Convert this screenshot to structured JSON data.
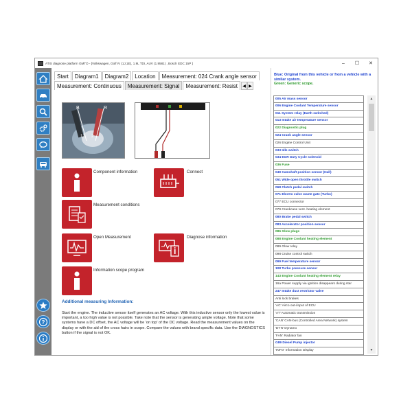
{
  "window": {
    "title": "ATIS diagnose platform GMTO - [Volkswagen, Golf IV (1J,1E), 1.9L TDI, AUV (1.9581) , Bosch EDC 15P ]",
    "controls": {
      "minimize": "–",
      "maximize": "☐",
      "close": "✕"
    }
  },
  "tabs_row1": [
    "Start",
    "Diagram1",
    "Diagram2",
    "Location",
    "Measurement: 024 Crank angle sensor"
  ],
  "tabs_row2": [
    "Measurement: Continuous",
    "Measurement: Signal",
    "Measurement: Resist"
  ],
  "tab_arrows": {
    "left": "◀",
    "right": "▶"
  },
  "photo_labels": {
    "b": "B",
    "r": "R",
    "one": "1",
    "two": "2"
  },
  "tiles": {
    "component_information": "Component information",
    "connect": "Connect",
    "measurement_conditions": "Measurement conditions",
    "open_measurement": "Open Measurement",
    "diagnose_information": "Diagnose information",
    "information_scope_program": "Information scope program"
  },
  "additional": {
    "title": "Additional measuring Information:",
    "text": "Start the engine. The inductive sensor itself generates an AC voltage. With this inductive sensor only the lowest value is important, a too high value is not possible. Take note that the sensor is generating ample voltage. Note that some systems have a DC offset, the AC voltage will be 'on top' of the DC voltage. Read the measurement values on the display or with the aid of the cross hairs in scope. Compare the values with brand specific data. Use the DIAGNOSTICS button if the signal is not OK."
  },
  "legend": {
    "blue": "Blue: Original from this vehicle or from a vehicle with a similar system.",
    "green": "Green: Generic scope."
  },
  "components": [
    {
      "label": "005 Air mass sensor",
      "color": "blue"
    },
    {
      "label": "006 Engine Coolant Temperature sensor",
      "color": "blue"
    },
    {
      "label": "011 System relay (Earth switched)",
      "color": "blue"
    },
    {
      "label": "013 Intake air temperature sensor",
      "color": "blue"
    },
    {
      "label": "022 Diagnostic plug",
      "color": "green"
    },
    {
      "label": "024 Crank angle sensor",
      "color": "blue"
    },
    {
      "label": "026 Engine Control Unit",
      "color": "plain"
    },
    {
      "label": "033 Idle switch",
      "color": "blue"
    },
    {
      "label": "034 EGR Duty Cycle solenoid",
      "color": "blue"
    },
    {
      "label": "036 Fuse",
      "color": "green"
    },
    {
      "label": "049 Camshaft position sensor (Hall)",
      "color": "blue"
    },
    {
      "label": "051 Wide open throttle switch",
      "color": "blue"
    },
    {
      "label": "068 Clutch pedal switch",
      "color": "blue"
    },
    {
      "label": "071 Electro valve waste gate (Turbo)",
      "color": "blue"
    },
    {
      "label": "077 ECU connector",
      "color": "plain"
    },
    {
      "label": "079 Crankcase vent. heating element",
      "color": "plain"
    },
    {
      "label": "080 Brake pedal switch",
      "color": "blue"
    },
    {
      "label": "083 Accelerator position sensor",
      "color": "blue"
    },
    {
      "label": "086 Glow plugs",
      "color": "green"
    },
    {
      "label": "088 Engine Coolant heating element",
      "color": "green"
    },
    {
      "label": "089 Glow relay",
      "color": "plain"
    },
    {
      "label": "098 Cruise control switch",
      "color": "plain"
    },
    {
      "label": "099 Fuel temperature sensor",
      "color": "blue"
    },
    {
      "label": "108 Turbo pressure sensor",
      "color": "blue"
    },
    {
      "label": "143 Engine Coolant heating element relay",
      "color": "green"
    },
    {
      "label": "16a Power supply via ignition disappears during star",
      "color": "plain"
    },
    {
      "label": "247 Intake duct restrictor valve",
      "color": "blue"
    },
    {
      "label": "Anti lock brakes",
      "color": "plain"
    },
    {
      "label": "'AC' Airco out-/input of ECU",
      "color": "plain"
    },
    {
      "label": "'AT' Automatic transmission",
      "color": "plain"
    },
    {
      "label": "'CAN' CAN-bus (Controlled Area Network) system",
      "color": "plain"
    },
    {
      "label": "'DYN' Dynamo",
      "color": "plain"
    },
    {
      "label": "'FAN' Radiator fan",
      "color": "plain"
    },
    {
      "label": "G89 Diesel Pump injector",
      "color": "blue"
    },
    {
      "label": "'INFO' Information Display",
      "color": "plain"
    }
  ],
  "icons": {
    "home": "home-icon",
    "car": "car-icon",
    "search": "search-icon",
    "gear": "gear-icon",
    "chat": "chat-icon",
    "vehicle": "vehicle-icon",
    "star": "star-icon",
    "help": "help-icon",
    "info": "info-icon"
  },
  "colors": {
    "accent_blue": "#2f7fc3",
    "tile_red": "#c3232b",
    "list_blue": "#1a3fcf",
    "list_green": "#2d9a2d",
    "sidebar": "#7b7b7b"
  }
}
